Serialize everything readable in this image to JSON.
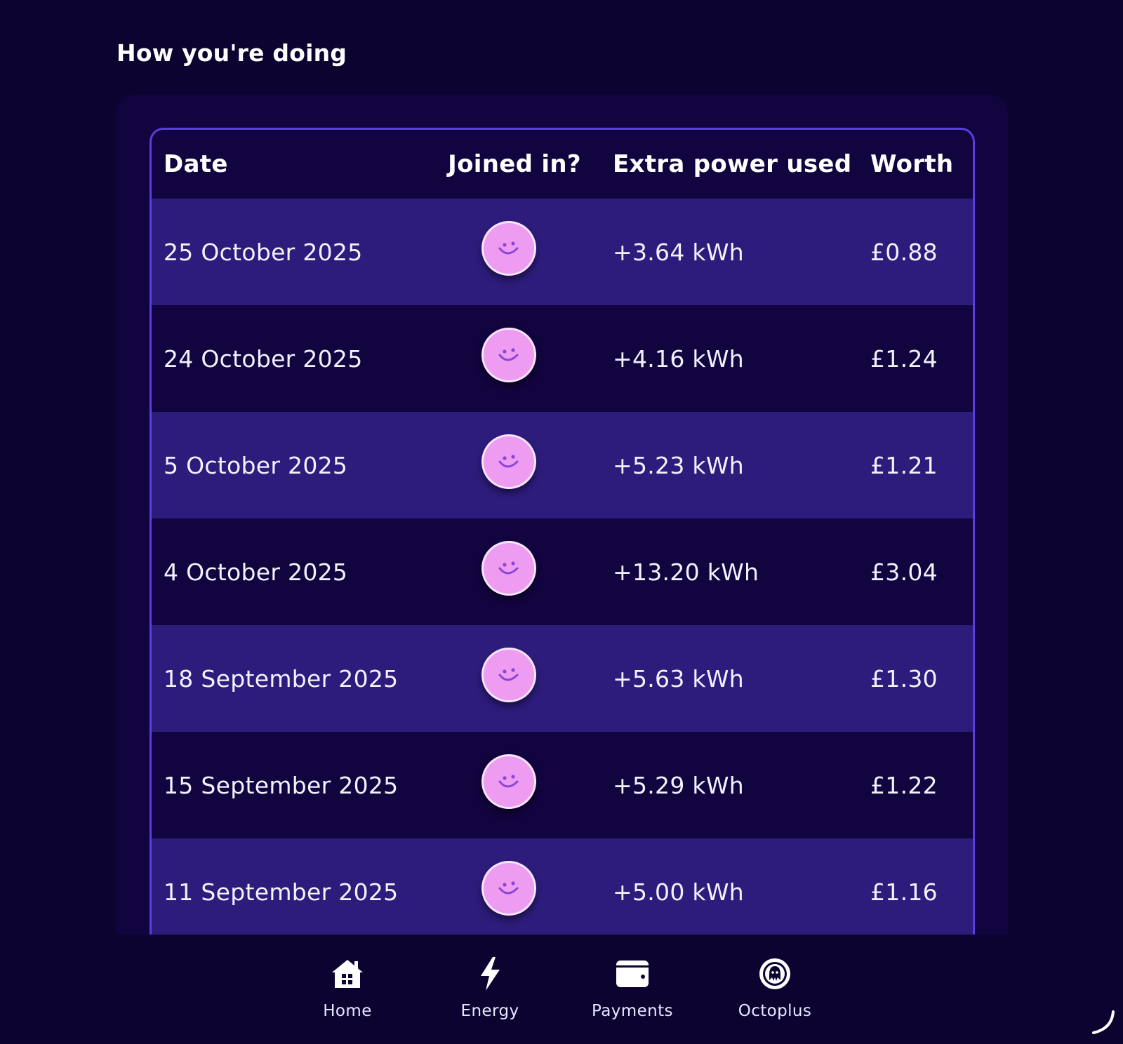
{
  "section": {
    "title": "How you're doing"
  },
  "table": {
    "headers": {
      "date": "Date",
      "joined": "Joined in?",
      "power": "Extra power used",
      "worth": "Worth"
    },
    "rows": [
      {
        "date": "25 October 2025",
        "joined_icon": "smiley-face-icon",
        "power": "+3.64 kWh",
        "worth": "£0.88"
      },
      {
        "date": "24 October 2025",
        "joined_icon": "smiley-face-icon",
        "power": "+4.16 kWh",
        "worth": "£1.24"
      },
      {
        "date": "5 October 2025",
        "joined_icon": "smiley-face-icon",
        "power": "+5.23 kWh",
        "worth": "£1.21"
      },
      {
        "date": "4 October 2025",
        "joined_icon": "smiley-face-icon",
        "power": "+13.20 kWh",
        "worth": "£3.04"
      },
      {
        "date": "18 September 2025",
        "joined_icon": "smiley-face-icon",
        "power": "+5.63 kWh",
        "worth": "£1.30"
      },
      {
        "date": "15 September 2025",
        "joined_icon": "smiley-face-icon",
        "power": "+5.29 kWh",
        "worth": "£1.22"
      },
      {
        "date": "11 September 2025",
        "joined_icon": "smiley-face-icon",
        "power": "+5.00 kWh",
        "worth": "£1.16"
      }
    ]
  },
  "nav": {
    "items": [
      {
        "label": "Home",
        "icon": "home-icon"
      },
      {
        "label": "Energy",
        "icon": "lightning-bolt-icon"
      },
      {
        "label": "Payments",
        "icon": "wallet-icon"
      },
      {
        "label": "Octoplus",
        "icon": "octoplus-coin-icon"
      }
    ]
  },
  "colors": {
    "background": "#0c0331",
    "card": "#12043f",
    "row_highlight": "#2d1c7c",
    "border_accent": "#5b3ee0",
    "smiley": "#ee9cf2"
  }
}
